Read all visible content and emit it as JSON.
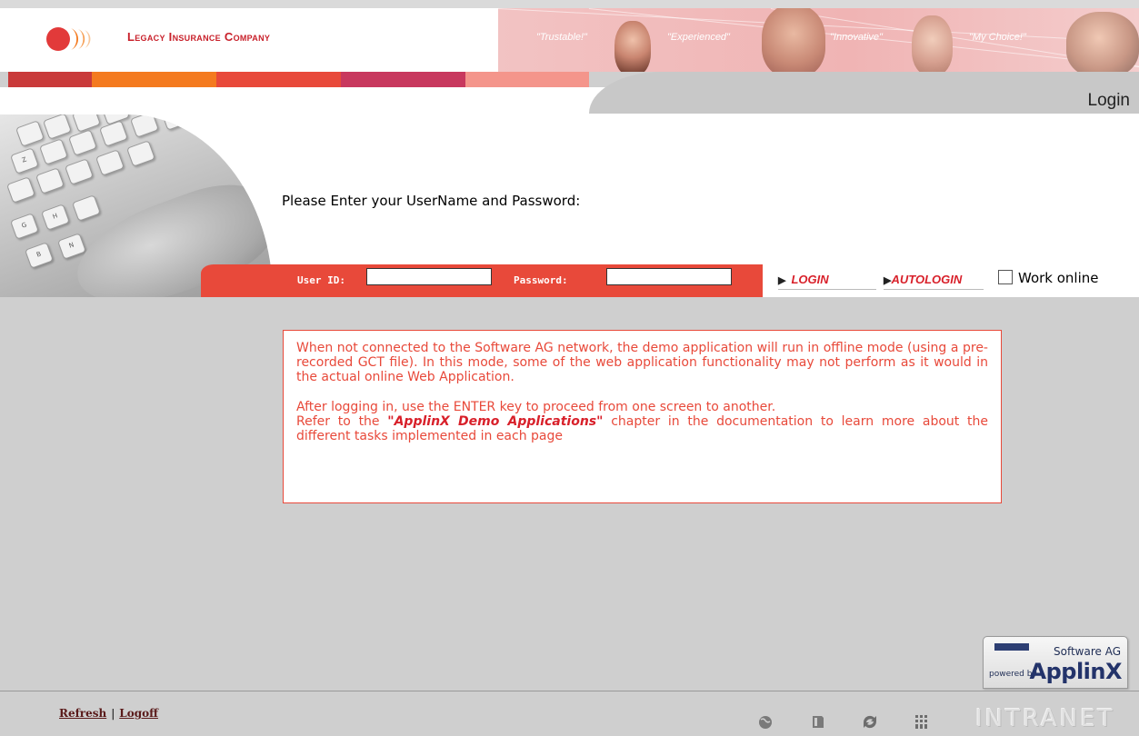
{
  "header": {
    "brand": "Legacy Insurance Company",
    "quotes": [
      "\"Trustable!\"",
      "\"Experienced\"",
      "\"Innovative\"",
      "\"My Choice!\""
    ],
    "stripe_colors": [
      "#c93a3a",
      "#f47a1f",
      "#e8493a",
      "#c8385e",
      "#f4958b"
    ]
  },
  "page": {
    "title": "Login",
    "prompt": "Please Enter your UserName and Password:"
  },
  "login_form": {
    "user_id_label": "User ID:",
    "user_id_value": "",
    "password_label": "Password:",
    "password_value": "",
    "login_button": "LOGIN",
    "autologin_button": "AUTOLOGIN",
    "work_online_label": "Work online",
    "work_online_checked": false
  },
  "info": {
    "para1": "When not connected to the Software AG network, the demo application will run in offline mode (using a pre-recorded GCT file). In this mode, some of the web application functionality may not perform as it would in the actual online Web Application.",
    "para2_line1": "After logging in, use the ENTER key to proceed from one screen to another.",
    "para2_pre": "Refer to the ",
    "para2_bold": "\"ApplinX Demo Applications\"",
    "para2_post": " chapter in the documentation to learn more about the different tasks implemented in each page"
  },
  "badge": {
    "company": "Software AG",
    "powered_by": "powered by",
    "product": "ApplinX"
  },
  "footer": {
    "refresh": "Refresh",
    "separator": "|",
    "logoff": "Logoff",
    "icons": [
      "globe-icon",
      "document-icon",
      "refresh-icon",
      "columns-icon"
    ],
    "watermark": "INTRANET"
  },
  "colors": {
    "accent_red": "#e8493a",
    "brand_red": "#c8202a",
    "background_gray": "#cfcfcf"
  }
}
